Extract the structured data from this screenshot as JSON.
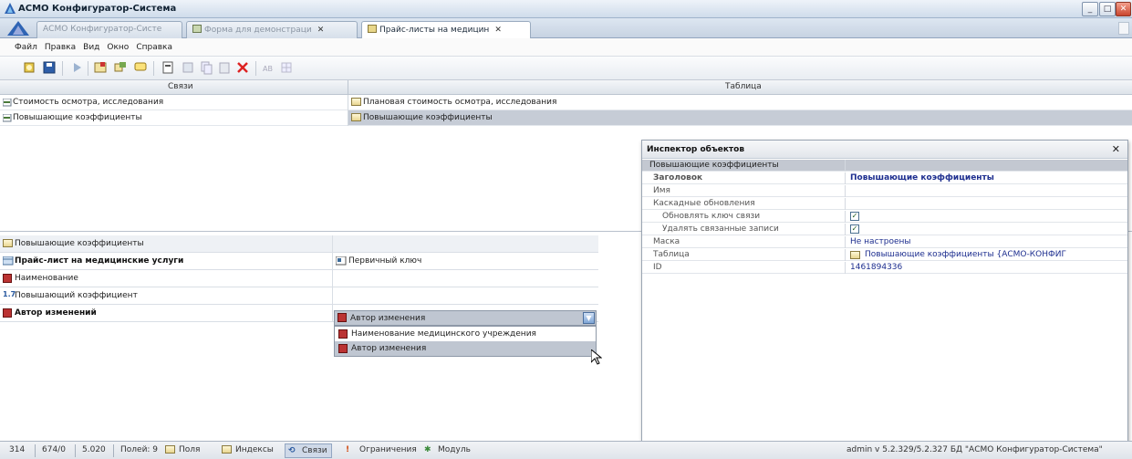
{
  "window": {
    "title": "АСМО Конфигуратор-Система"
  },
  "tabs": [
    {
      "label": "АСМО Конфигуратор-Систе"
    },
    {
      "label": "Форма для демонстраци"
    },
    {
      "label": "Прайс-листы на медицин"
    }
  ],
  "menu": [
    "Файл",
    "Правка",
    "Вид",
    "Окно",
    "Справка"
  ],
  "header": {
    "left": "Связи",
    "right": "Таблица"
  },
  "relations": [
    {
      "left": "Стоимость осмотра, исследования",
      "right": "Плановая стоимость осмотра, исследования"
    },
    {
      "left": "Повышающие коэффициенты",
      "right": "Повышающие коэффициенты"
    }
  ],
  "fields": {
    "header": "Повышающие коэффициенты",
    "rows": [
      {
        "label": "Прайс-лист на медицинские услуги",
        "value": "Первичный ключ"
      },
      {
        "label": "Наименование",
        "value": ""
      },
      {
        "label": "Повышающий коэффициент",
        "value": ""
      },
      {
        "label": "Автор изменений",
        "value": "Автор изменения"
      }
    ],
    "dropdown_options": [
      "Наименование медицинского учреждения",
      "Автор изменения"
    ]
  },
  "inspector": {
    "title": "Инспектор объектов",
    "group": "Повышающие коэффициенты",
    "props": [
      {
        "name": "Заголовок",
        "value": "Повышающие коэффициенты"
      },
      {
        "name": "Имя",
        "value": ""
      },
      {
        "name": "Каскадные обновления",
        "value": ""
      },
      {
        "name": "Обновлять ключ связи",
        "value": ""
      },
      {
        "name": "Удалять связанные записи",
        "value": ""
      },
      {
        "name": "Маска",
        "value": "Не настроены"
      },
      {
        "name": "Таблица",
        "value": "Повышающие коэффициенты {АСМО-КОНФИГ"
      },
      {
        "name": "ID",
        "value": "1461894336"
      }
    ],
    "checks": [
      true,
      true
    ]
  },
  "status": {
    "a": "314",
    "b": "674/0",
    "c": "5.020",
    "fields": "Полей: 9",
    "tabs": [
      "Поля",
      "Индексы",
      "Связи",
      "Ограничения",
      "Модуль"
    ],
    "right": "admin v 5.2.329/5.2.327 БД \"АСМО Конфигуратор-Система\""
  },
  "colors": {
    "accent": "#2f64b4",
    "selection": "#c6ccd6",
    "link": "#1d2e8f"
  }
}
